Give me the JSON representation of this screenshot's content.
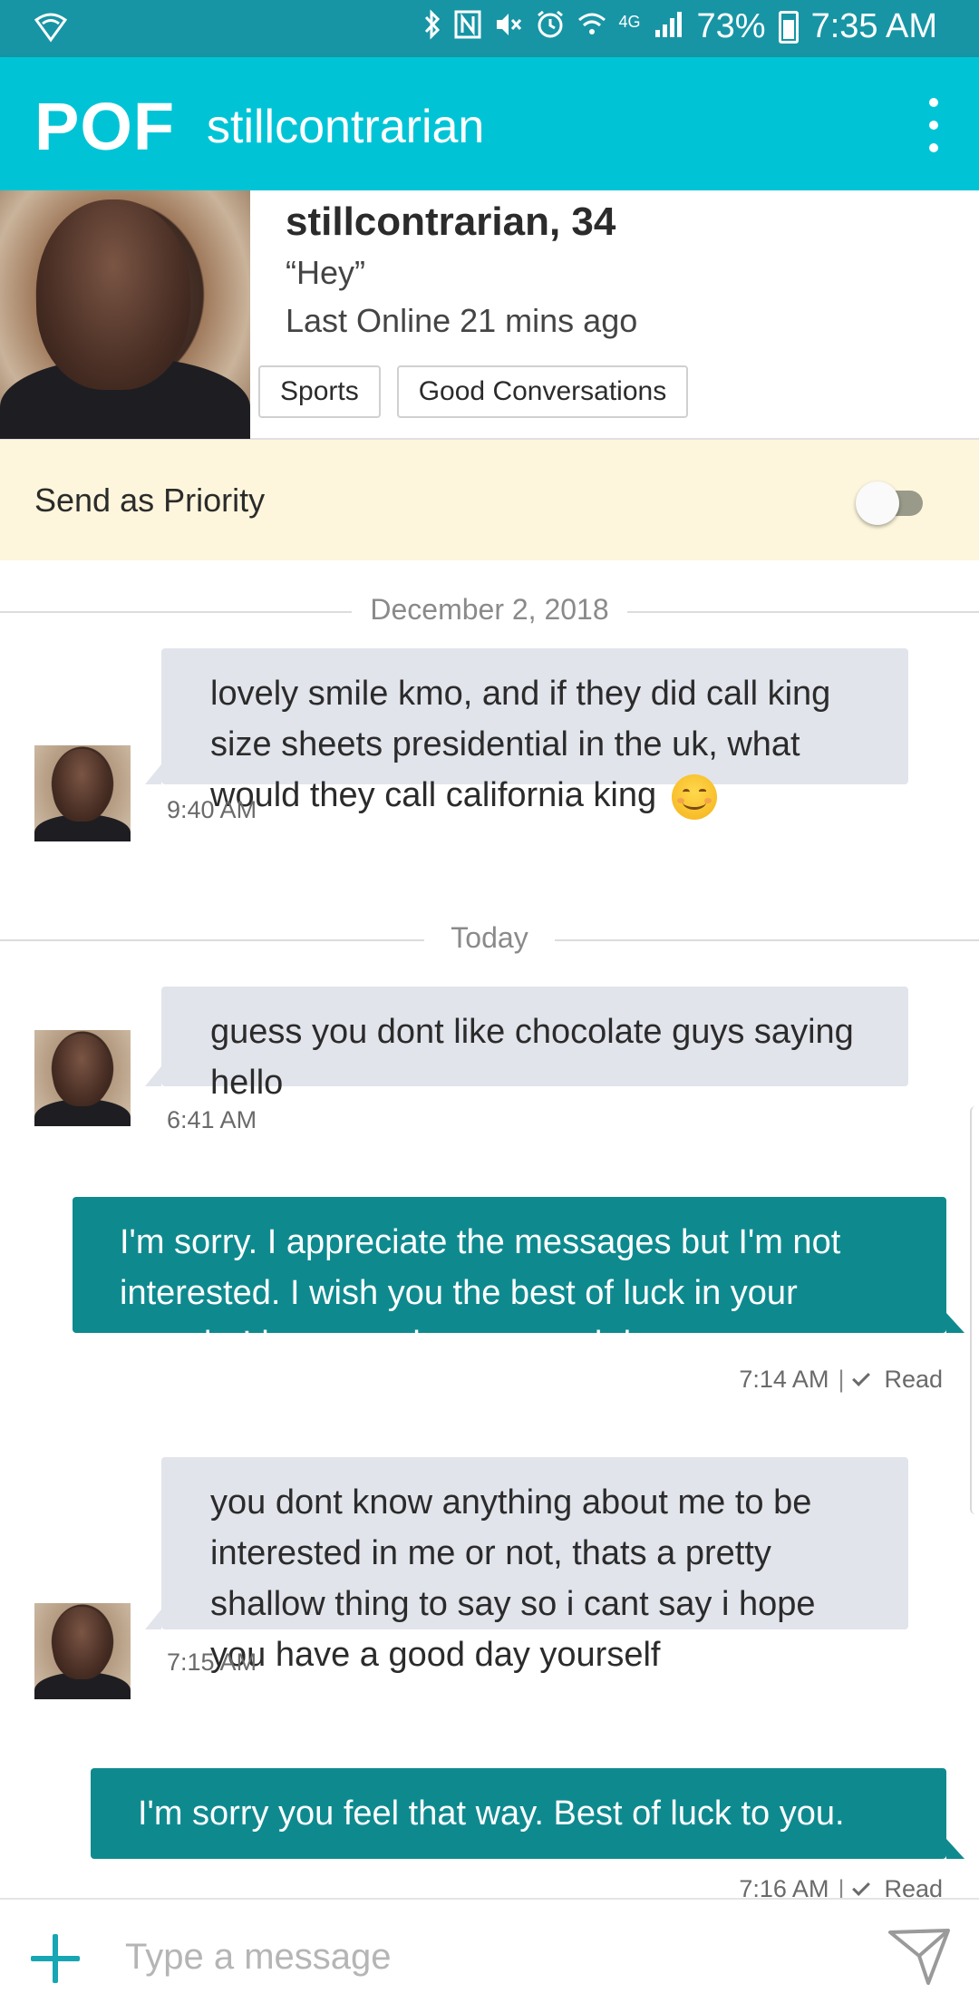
{
  "status_bar": {
    "battery": "73%",
    "time": "7:35 AM",
    "network": "4G",
    "icons": [
      "wifi-shield-icon",
      "bluetooth-icon",
      "nfc-icon",
      "mute-icon",
      "alarm-icon",
      "wifi-icon",
      "signal-icon",
      "battery-icon"
    ]
  },
  "app_bar": {
    "logo": "POF",
    "title": "stillcontrarian",
    "menu_icon": "more-vert-icon"
  },
  "profile": {
    "name_age": "stillcontrarian, 34",
    "headline": "“Hey”",
    "last_online": "Last Online 21 mins ago",
    "tags": [
      "Sports",
      "Good Conversations"
    ]
  },
  "priority": {
    "label": "Send as Priority",
    "enabled": false
  },
  "conversation": {
    "date_1": "December 2, 2018",
    "date_2": "Today",
    "messages": [
      {
        "direction": "incoming",
        "text": "lovely smile kmo, and if they did call king size sheets presidential in the uk, what would they call california king",
        "emoji": "smiling-face-emoji",
        "time": "9:40 AM"
      },
      {
        "direction": "incoming",
        "text": "guess you dont like chocolate guys saying hello",
        "time": "6:41 AM"
      },
      {
        "direction": "outgoing",
        "text": "I'm sorry.  I appreciate the messages but I'm not interested.  I wish you the best of luck in your search.  I hope you have a good day.",
        "time": "7:14 AM",
        "status": "Read"
      },
      {
        "direction": "incoming",
        "text": "you dont know anything about me to be interested in me or not, thats a pretty shallow thing to say so i cant say i hope you have a good day yourself",
        "time": "7:15 AM"
      },
      {
        "direction": "outgoing",
        "text": "I'm sorry you feel that way.  Best of luck to you.",
        "time": "7:16 AM",
        "status": "Read"
      }
    ]
  },
  "composer": {
    "placeholder": "Type a message",
    "value": "",
    "attach_icon": "plus-icon",
    "send_icon": "send-icon"
  },
  "colors": {
    "status_bar": "#1795a5",
    "app_bar": "#00c4d6",
    "incoming_bubble": "#e2e4ec",
    "outgoing_bubble": "#0e8a8f",
    "priority_bg": "#fdf6dc"
  }
}
